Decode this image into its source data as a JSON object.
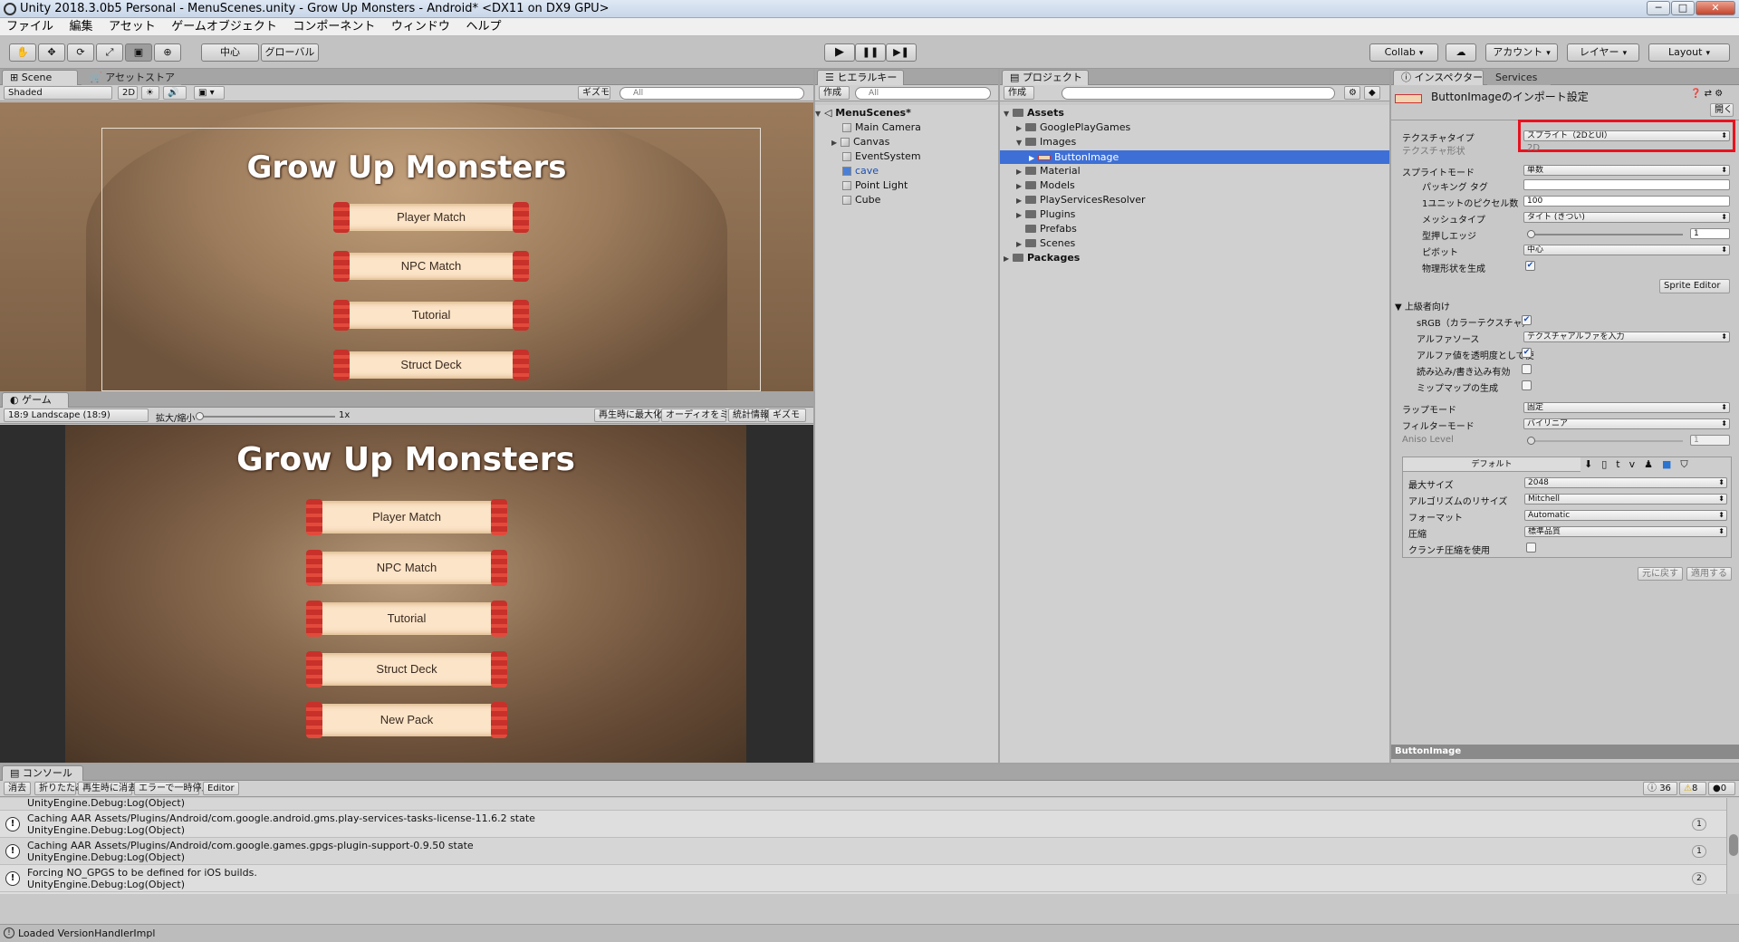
{
  "window": {
    "title": "Unity 2018.3.0b5 Personal - MenuScenes.unity - Grow Up Monsters - Android* <DX11 on DX9 GPU>",
    "minimize": "─",
    "maximize": "□",
    "close": "✕"
  },
  "menu": [
    "ファイル",
    "編集",
    "アセット",
    "ゲームオブジェクト",
    "コンポーネント",
    "ウィンドウ",
    "ヘルプ"
  ],
  "toolbar": {
    "tools": [
      "✋",
      "✥",
      "⟳",
      "⤢",
      "▣",
      "⊕"
    ],
    "pivot": "中心",
    "space": "グローバル",
    "play": "▶",
    "pause": "❚❚",
    "step": "▶❚",
    "collab": "Collab",
    "cloud": "☁",
    "account": "アカウント",
    "layers": "レイヤー",
    "layout": "Layout"
  },
  "scene": {
    "tab_scene": "Scene",
    "tab_store": "アセットストア",
    "shading": "Shaded",
    "mode2d": "2D",
    "gizmos": "ギズモ",
    "search": "All",
    "title": "Grow Up Monsters",
    "buttons": [
      "Player Match",
      "NPC Match",
      "Tutorial",
      "Struct Deck"
    ]
  },
  "game": {
    "tab": "ゲーム",
    "aspect": "18:9 Landscape (18:9)",
    "scale_label": "拡大/縮小",
    "scale_value": "1x",
    "maximize": "再生時に最大化",
    "mute": "オーディオをミュート",
    "stats": "統計情報",
    "gizmos": "ギズモ",
    "title": "Grow Up Monsters",
    "buttons": [
      "Player Match",
      "NPC Match",
      "Tutorial",
      "Struct Deck",
      "New Pack"
    ]
  },
  "hierarchy": {
    "tab": "ヒエラルキー",
    "create": "作成",
    "search": "All",
    "scene": "MenuScenes*",
    "items": [
      "Main Camera",
      "Canvas",
      "EventSystem",
      "cave",
      "Point Light",
      "Cube"
    ]
  },
  "project": {
    "tab": "プロジェクト",
    "create": "作成",
    "items": [
      "Assets",
      "GooglePlayGames",
      "Images",
      "ButtonImage",
      "Material",
      "Models",
      "PlayServicesResolver",
      "Plugins",
      "Prefabs",
      "Scenes",
      "Packages"
    ]
  },
  "inspector": {
    "tab": "インスペクター",
    "tab2": "Services",
    "header": "ButtonImageのインポート設定",
    "open": "開く",
    "texture_type_label": "テクスチャタイプ",
    "texture_type_value": "スプライト（2DとUI）",
    "texture_shape_label": "テクスチャ形状",
    "texture_shape_value": "2D",
    "sprite_mode_label": "スプライトモード",
    "sprite_mode_value": "単数",
    "packing_tag_label": "パッキング タグ",
    "ppu_label": "1ユニットのピクセル数",
    "ppu_value": "100",
    "mesh_type_label": "メッシュタイプ",
    "mesh_type_value": "タイト (きつい)",
    "extrude_label": "型押しエッジ",
    "extrude_value": "1",
    "pivot_label": "ピボット",
    "pivot_value": "中心",
    "physics_label": "物理形状を生成",
    "sprite_editor": "Sprite Editor",
    "advanced_label": "上級者向け",
    "srgb_label": "sRGB（カラーテクスチャ）",
    "alpha_source_label": "アルファソース",
    "alpha_source_value": "テクスチャアルファを入力",
    "alpha_transparency_label": "アルファ値を透明度として使",
    "readwrite_label": "読み込み/書き込み有効",
    "mipmap_label": "ミップマップの生成",
    "wrap_label": "ラップモード",
    "wrap_value": "固定",
    "filter_label": "フィルターモード",
    "filter_value": "バイリニア",
    "aniso_label": "Aniso Level",
    "aniso_value": "1",
    "platform_default": "デフォルト",
    "max_size_label": "最大サイズ",
    "max_size_value": "2048",
    "resize_label": "アルゴリズムのリサイズ",
    "resize_value": "Mitchell",
    "format_label": "フォーマット",
    "format_value": "Automatic",
    "compression_label": "圧縮",
    "compression_value": "標準品質",
    "crunch_label": "クランチ圧縮を使用",
    "revert": "元に戻す",
    "apply": "適用する",
    "preview": "ButtonImage"
  },
  "console": {
    "tab": "コンソール",
    "clear": "消去",
    "collapse": "折りたたみ",
    "clear_on_play": "再生時に消去",
    "error_pause": "エラーで一時停止",
    "editor": "Editor",
    "count_log": "36",
    "count_warn": "8",
    "count_err": "0",
    "rows": [
      {
        "line1": "UnityEngine.Debug:Log(Object)",
        "line2": "",
        "count": ""
      },
      {
        "line1": "Caching AAR Assets/Plugins/Android/com.google.android.gms.play-services-tasks-license-11.6.2 state",
        "line2": "UnityEngine.Debug:Log(Object)",
        "count": "1"
      },
      {
        "line1": "Caching AAR Assets/Plugins/Android/com.google.games.gpgs-plugin-support-0.9.50 state",
        "line2": "UnityEngine.Debug:Log(Object)",
        "count": "1"
      },
      {
        "line1": "Forcing NO_GPGS to be defined for iOS builds.",
        "line2": "UnityEngine.Debug:Log(Object)",
        "count": "2"
      }
    ]
  },
  "status": "Loaded VersionHandlerImpl",
  "colors": {
    "highlight": "#e8121e",
    "selection": "#3d6fd6"
  }
}
